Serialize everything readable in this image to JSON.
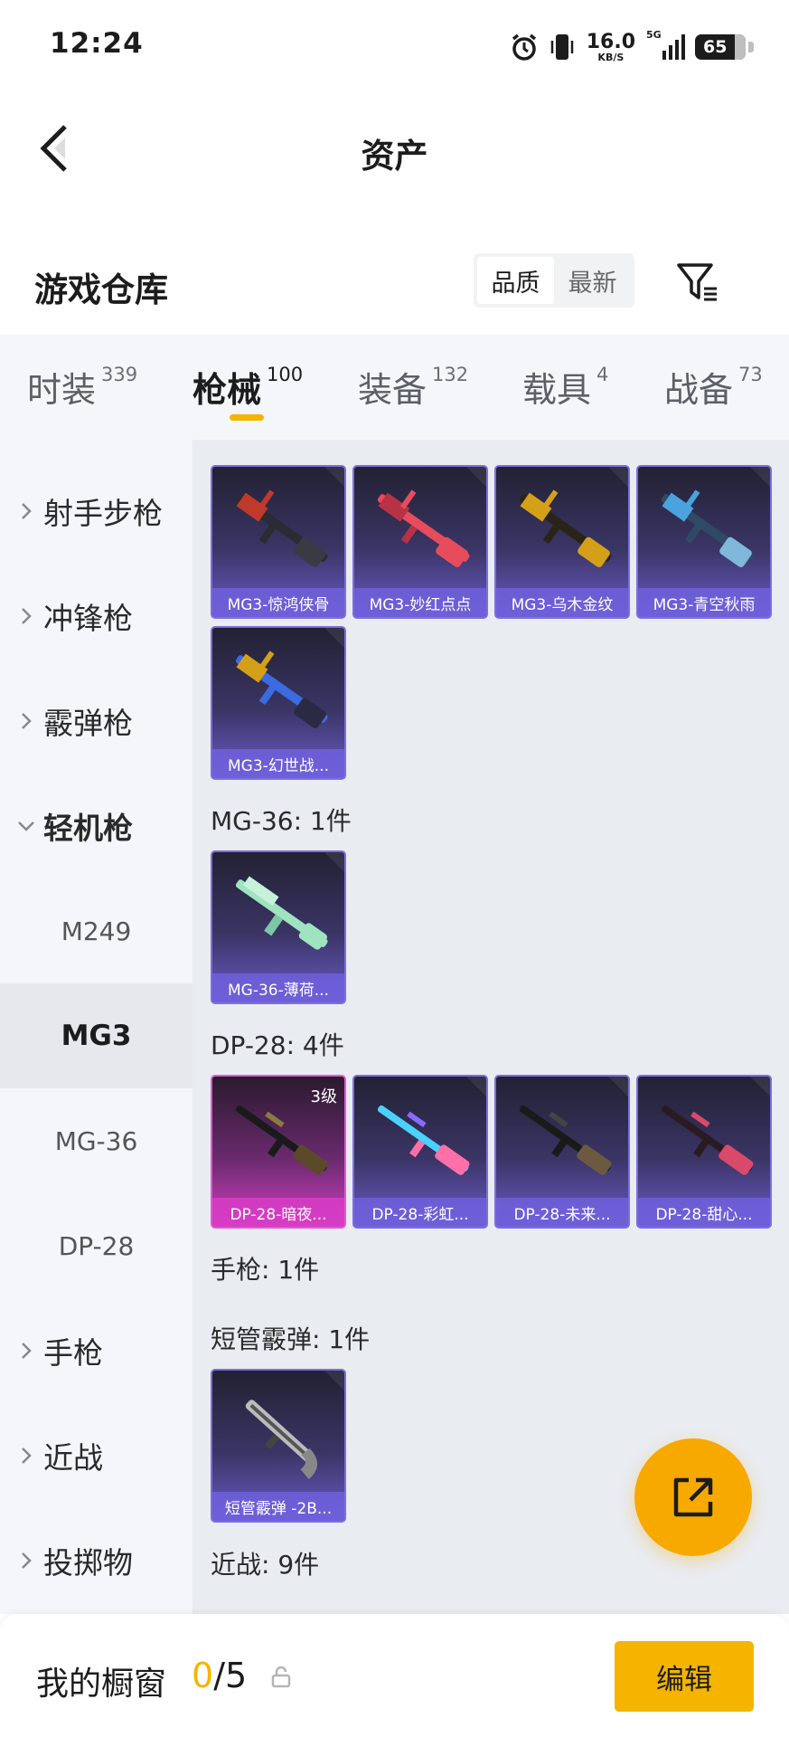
{
  "status_bar": {
    "time": "12:24",
    "net_speed": "16.0",
    "net_unit": "KB/S",
    "signal_label": "5G",
    "battery": "65"
  },
  "nav": {
    "title": "资产"
  },
  "header": {
    "title": "游戏仓库",
    "sort_options": [
      {
        "label": "品质",
        "active": true
      },
      {
        "label": "最新",
        "active": false
      }
    ]
  },
  "tabs": [
    {
      "label": "时装",
      "count": "339",
      "active": false
    },
    {
      "label": "枪械",
      "count": "100",
      "active": true
    },
    {
      "label": "装备",
      "count": "132",
      "active": false
    },
    {
      "label": "载具",
      "count": "4",
      "active": false
    },
    {
      "label": "战备",
      "count": "73",
      "active": false
    }
  ],
  "sidebar": {
    "categories": [
      {
        "label": "射手步枪",
        "expanded": false
      },
      {
        "label": "冲锋枪",
        "expanded": false
      },
      {
        "label": "霰弹枪",
        "expanded": false
      },
      {
        "label": "轻机枪",
        "expanded": true
      }
    ],
    "subitems": [
      {
        "label": "M249",
        "active": false
      },
      {
        "label": "MG3",
        "active": true
      },
      {
        "label": "MG-36",
        "active": false
      },
      {
        "label": "DP-28",
        "active": false
      }
    ],
    "more_categories": [
      {
        "label": "手枪"
      },
      {
        "label": "近战"
      },
      {
        "label": "投掷物"
      }
    ]
  },
  "content": {
    "mg3_items": [
      {
        "name": "MG3-惊鸿侠骨",
        "palette": "#c0392b"
      },
      {
        "name": "MG3-妙红点点",
        "palette": "#e74c5c"
      },
      {
        "name": "MG3-乌木金纹",
        "palette": "#d4a017"
      },
      {
        "name": "MG3-青空秋雨",
        "palette": "#4aa3df"
      },
      {
        "name": "MG3-幻世战...",
        "palette": "#3b6be0"
      }
    ],
    "mg36_label": "MG-36: 1件",
    "mg36_items": [
      {
        "name": "MG-36-薄荷...",
        "palette": "#9fe3c0"
      }
    ],
    "dp28_label": "DP-28: 4件",
    "dp28_items": [
      {
        "name": "DP-28-暗夜...",
        "level": "3级",
        "palette": "#8a7a40"
      },
      {
        "name": "DP-28-彩虹...",
        "palette": "#ff6fa8"
      },
      {
        "name": "DP-28-未来...",
        "palette": "#6b5a40"
      },
      {
        "name": "DP-28-甜心...",
        "palette": "#d94a6a"
      }
    ],
    "pistol_label": "手枪: 1件",
    "shotgun_label": "短管霰弹: 1件",
    "shotgun_items": [
      {
        "name": "短管霰弹 -2B...",
        "palette": "#bbbbbb"
      }
    ],
    "melee_label": "近战: 9件"
  },
  "bottom_bar": {
    "label": "我的橱窗",
    "current": "0",
    "separator_total": "/5",
    "edit_label": "编辑"
  },
  "colors": {
    "accent": "#f5b400",
    "card_purple": "#6a5cc9",
    "card_pink": "#d43fc0",
    "fab": "#f7a900"
  },
  "icons": {
    "back": "chevron-left-icon",
    "filter": "filter-icon",
    "lock": "lock-icon",
    "share": "share-external-icon"
  }
}
